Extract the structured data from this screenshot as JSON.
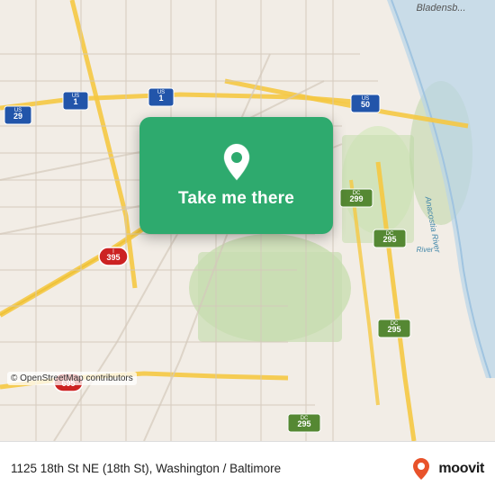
{
  "map": {
    "attribution": "© OpenStreetMap contributors",
    "bg_color": "#e8e0d8"
  },
  "card": {
    "label": "Take me there",
    "pin_icon": "location-pin"
  },
  "bottom_bar": {
    "address": "1125 18th St NE (18th St), Washington / Baltimore",
    "brand": "moovit"
  }
}
